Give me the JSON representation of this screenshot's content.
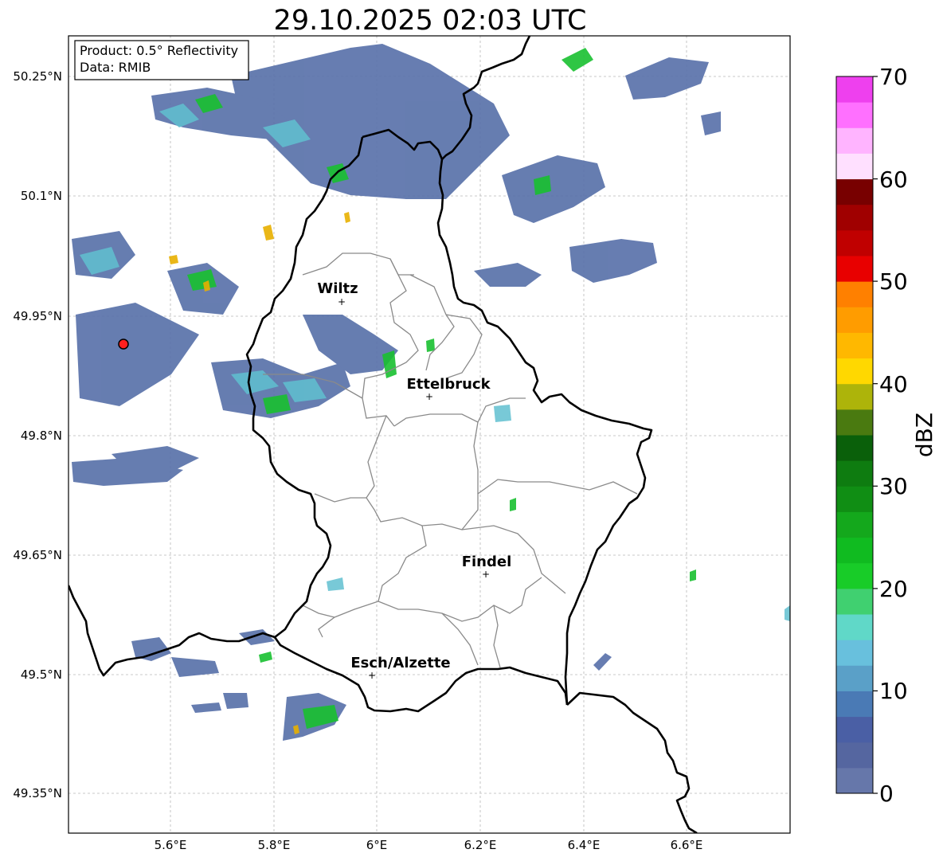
{
  "title": "29.10.2025 02:03 UTC",
  "info_box": {
    "product": "Product: 0.5° Reflectivity",
    "source": "Data: RMIB"
  },
  "colorbar": {
    "label": "dBZ",
    "ticks": [
      "0",
      "10",
      "20",
      "30",
      "40",
      "50",
      "60",
      "70"
    ],
    "colors": [
      "#6677aa",
      "#5566a0",
      "#4a5fa5",
      "#4a7ab5",
      "#5aa0c8",
      "#68c0dd",
      "#60d8c8",
      "#40d070",
      "#18cc28",
      "#10bb20",
      "#14a81c",
      "#108e14",
      "#0e7c10",
      "#0a600a",
      "#4a7a10",
      "#adb40a",
      "#ffd800",
      "#ffb800",
      "#ff9c00",
      "#ff8000",
      "#e80000",
      "#c00000",
      "#a00000",
      "#780000",
      "#ffe0ff",
      "#ffb4ff",
      "#ff70ff",
      "#ee40ee"
    ]
  },
  "axes": {
    "lat_labels": [
      "50.25°N",
      "50.1°N",
      "49.95°N",
      "49.8°N",
      "49.65°N",
      "49.5°N",
      "49.35°N"
    ],
    "lon_labels": [
      "5.6°E",
      "5.8°E",
      "6°E",
      "6.2°E",
      "6.4°E",
      "6.6°E"
    ]
  },
  "cities": [
    {
      "name": "Wiltz"
    },
    {
      "name": "Ettelbruck"
    },
    {
      "name": "Findel"
    },
    {
      "name": "Esch/Alzette"
    }
  ]
}
